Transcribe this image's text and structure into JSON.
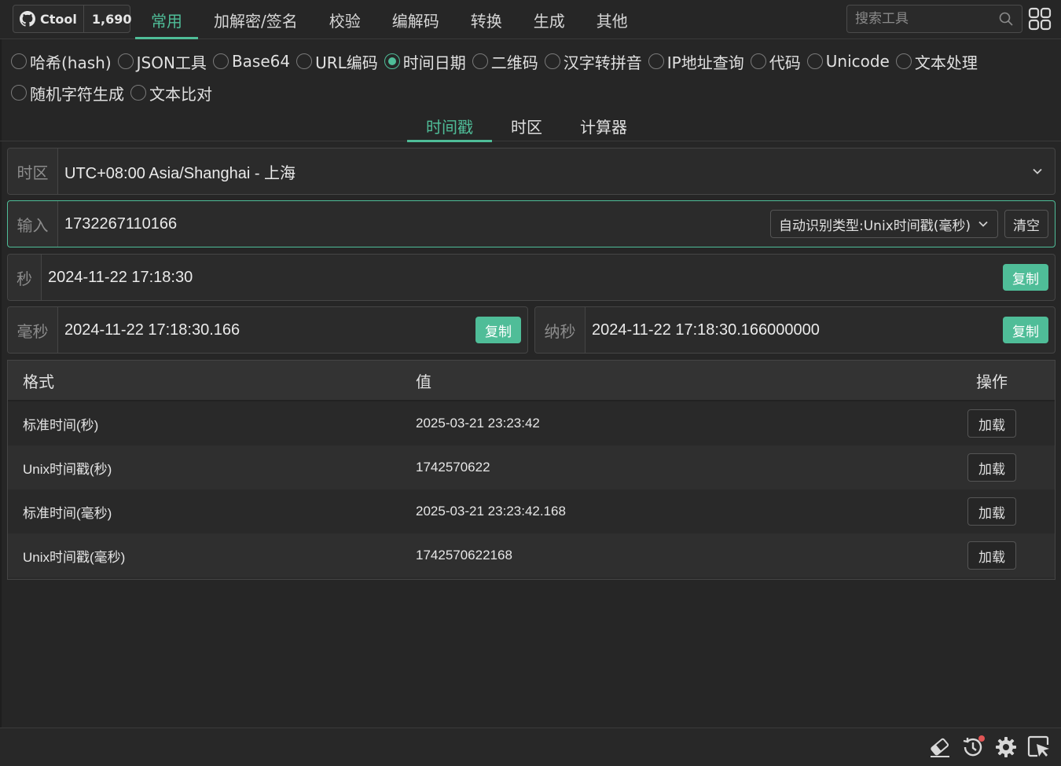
{
  "github": {
    "label": "Ctool",
    "stars": "1,690"
  },
  "categories": [
    {
      "label": "常用",
      "active": true
    },
    {
      "label": "加解密/签名"
    },
    {
      "label": "校验"
    },
    {
      "label": "编解码"
    },
    {
      "label": "转换"
    },
    {
      "label": "生成"
    },
    {
      "label": "其他"
    }
  ],
  "search": {
    "placeholder": "搜索工具"
  },
  "tools": [
    {
      "label": "哈希(hash)",
      "selected": false
    },
    {
      "label": "JSON工具",
      "selected": false
    },
    {
      "label": "Base64",
      "selected": false
    },
    {
      "label": "URL编码",
      "selected": false
    },
    {
      "label": "时间日期",
      "selected": true
    },
    {
      "label": "二维码",
      "selected": false
    },
    {
      "label": "汉字转拼音",
      "selected": false
    },
    {
      "label": "IP地址查询",
      "selected": false
    },
    {
      "label": "代码",
      "selected": false
    },
    {
      "label": "Unicode",
      "selected": false
    },
    {
      "label": "文本处理",
      "selected": false
    },
    {
      "label": "随机字符生成",
      "selected": false
    },
    {
      "label": "文本比对",
      "selected": false
    }
  ],
  "subtabs": [
    {
      "label": "时间戳",
      "active": true
    },
    {
      "label": "时区"
    },
    {
      "label": "计算器"
    }
  ],
  "timezone": {
    "prefix": "时区",
    "value": "UTC+08:00 Asia/Shanghai - 上海"
  },
  "input": {
    "prefix": "输入",
    "value": "1732267110166",
    "type_select": "自动识别类型:Unix时间戳(毫秒)",
    "clear_label": "清空"
  },
  "seconds": {
    "prefix": "秒",
    "value": "2024-11-22 17:18:30",
    "copy": "复制"
  },
  "millis": {
    "prefix": "毫秒",
    "value": "2024-11-22 17:18:30.166",
    "copy": "复制"
  },
  "nanos": {
    "prefix": "纳秒",
    "value": "2024-11-22 17:18:30.166000000",
    "copy": "复制"
  },
  "table": {
    "headers": {
      "format": "格式",
      "value": "值",
      "action": "操作"
    },
    "rows": [
      {
        "format": "标准时间(秒)",
        "value": "2025-03-21 23:23:42",
        "action": "加载"
      },
      {
        "format": "Unix时间戳(秒)",
        "value": "1742570622",
        "action": "加载"
      },
      {
        "format": "标准时间(毫秒)",
        "value": "2025-03-21 23:23:42.168",
        "action": "加载"
      },
      {
        "format": "Unix时间戳(毫秒)",
        "value": "1742570622168",
        "action": "加载"
      }
    ]
  },
  "footer_icons": [
    "eraser-icon",
    "history-icon",
    "settings-icon",
    "pointer-select-icon"
  ],
  "colors": {
    "accent": "#4fbd98",
    "background": "#262626",
    "notification_dot": "#e05555"
  }
}
